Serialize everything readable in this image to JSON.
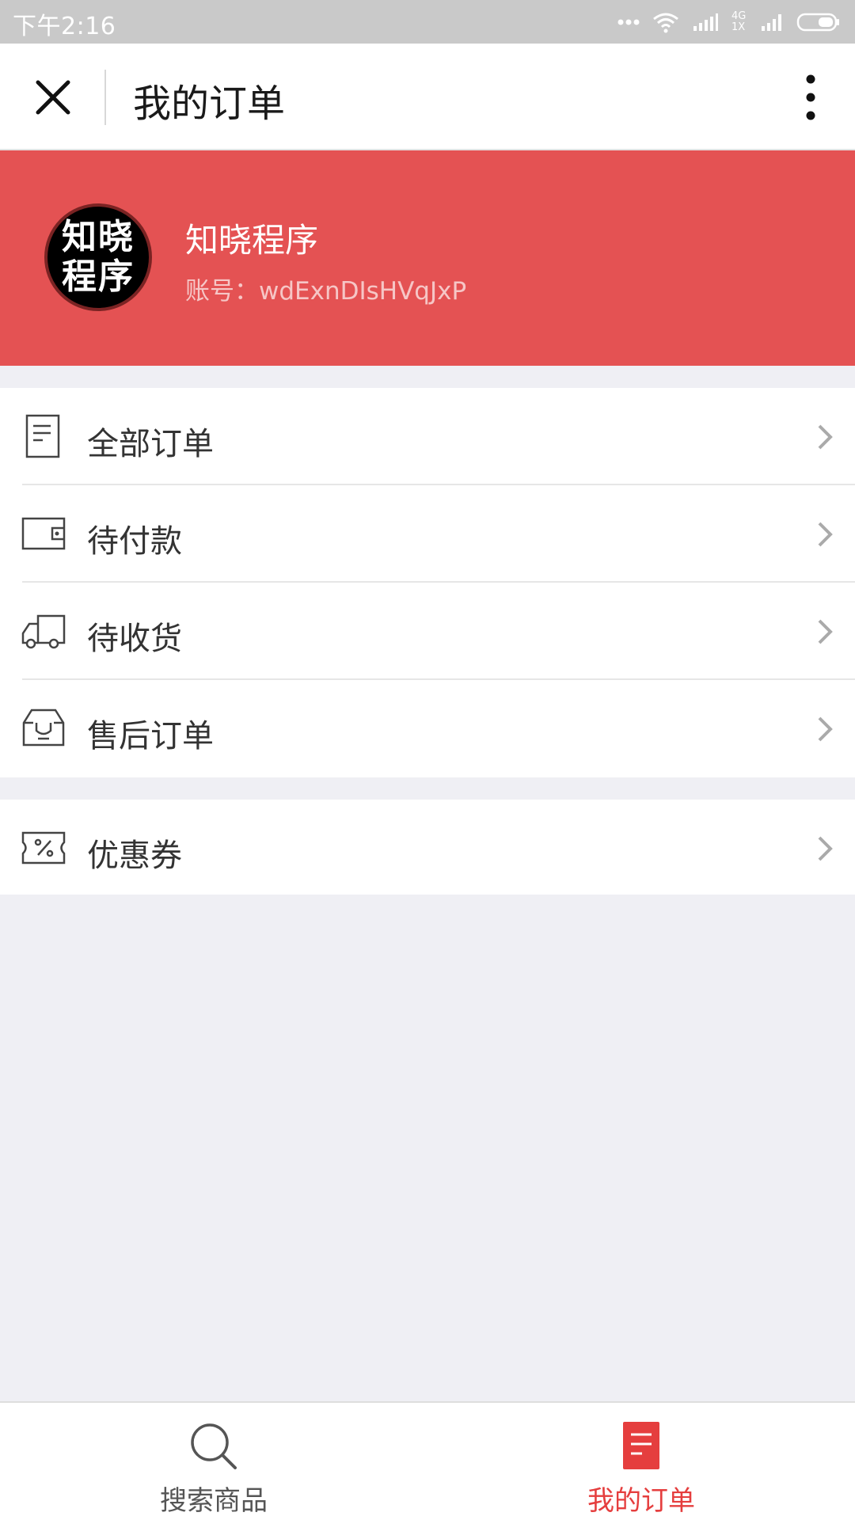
{
  "status_bar": {
    "time": "下午2:16",
    "network": "4G 1X"
  },
  "header": {
    "title": "我的订单"
  },
  "profile": {
    "avatar_logo": "知晓程序",
    "name": "知晓程序",
    "account": "账号：wdExnDIsHVqJxP"
  },
  "menu": {
    "items": [
      {
        "label": "全部订单",
        "icon": "document-icon"
      },
      {
        "label": "待付款",
        "icon": "wallet-icon"
      },
      {
        "label": "待收货",
        "icon": "truck-icon"
      },
      {
        "label": "售后订单",
        "icon": "return-bag-icon"
      }
    ],
    "extra": [
      {
        "label": "优惠券",
        "icon": "coupon-icon"
      }
    ]
  },
  "tabbar": {
    "tabs": [
      {
        "label": "搜索商品",
        "icon": "search-icon",
        "active": false
      },
      {
        "label": "我的订单",
        "icon": "orders-icon",
        "active": true
      }
    ]
  },
  "colors": {
    "accent": "#e45253",
    "active_tab": "#e53e3e",
    "background": "#efeff4"
  }
}
